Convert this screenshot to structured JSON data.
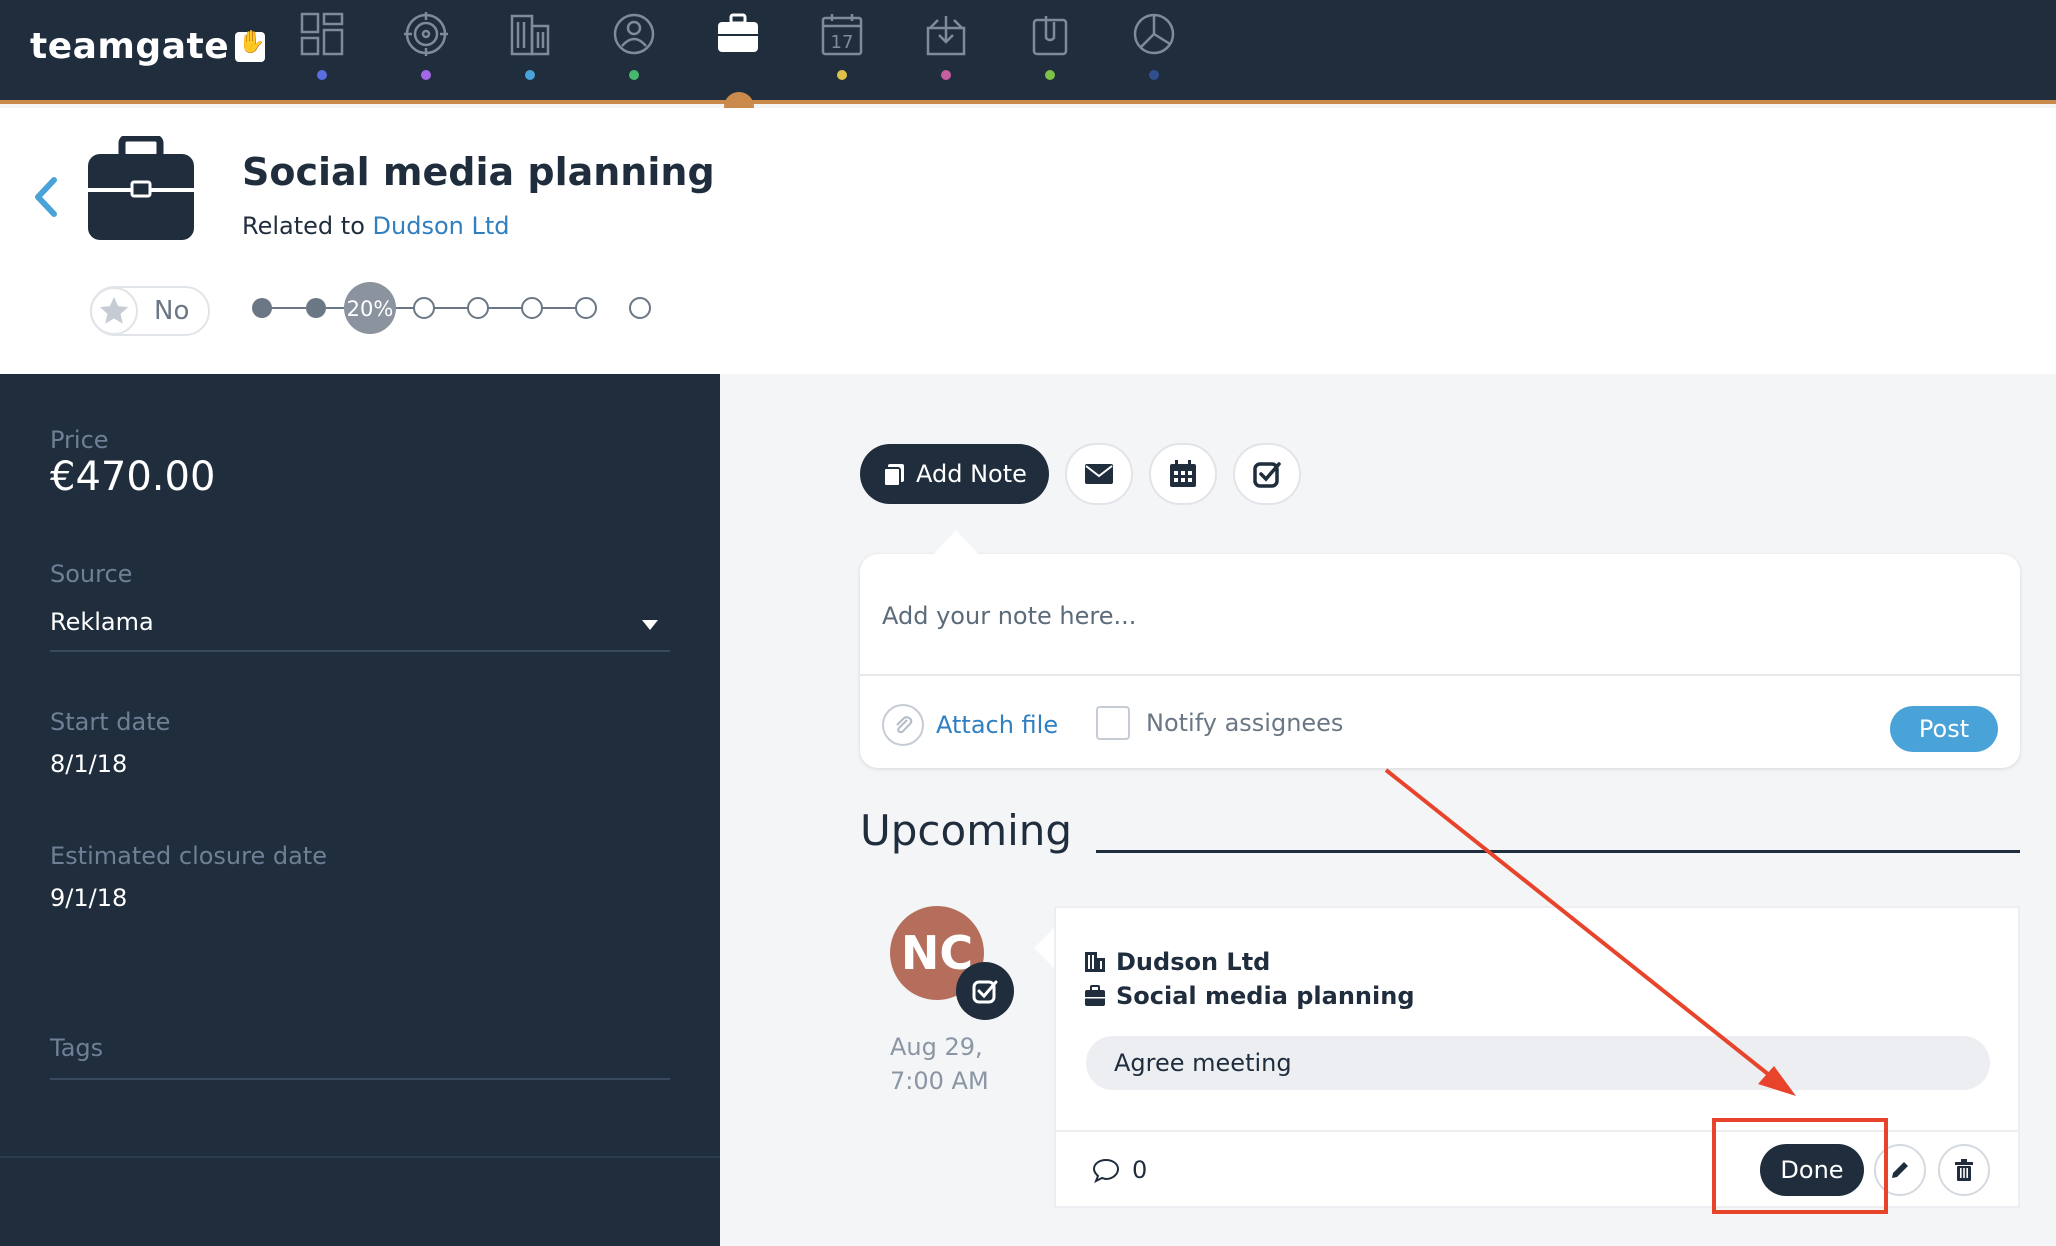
{
  "app": {
    "logo_text": "teamgate",
    "nav": [
      {
        "icon": "dashboard-icon",
        "dot_color": "#5b6ee1"
      },
      {
        "icon": "target-icon",
        "dot_color": "#a368e6"
      },
      {
        "icon": "building-icon",
        "dot_color": "#4aa3d8"
      },
      {
        "icon": "contacts-icon",
        "dot_color": "#47b86d"
      },
      {
        "icon": "briefcase-icon",
        "dot_color": "#c98a4b",
        "active": true
      },
      {
        "icon": "calendar-icon",
        "dot_color": "#e0c14a"
      },
      {
        "icon": "inbox-icon",
        "dot_color": "#c65ea0"
      },
      {
        "icon": "attachments-icon",
        "dot_color": "#7ec04a"
      },
      {
        "icon": "reports-icon",
        "dot_color": "#2f4f8f"
      }
    ]
  },
  "header": {
    "title": "Social media planning",
    "related_prefix": "Related to",
    "related_link": "Dudson Ltd",
    "favorite_label": "No",
    "pipeline": {
      "progress_label": "20%",
      "stages_total": 8,
      "current_stage": 3
    }
  },
  "sidebar": {
    "price_label": "Price",
    "price_value": "€470.00",
    "source_label": "Source",
    "source_value": "Reklama",
    "start_label": "Start date",
    "start_value": "8/1/18",
    "close_label": "Estimated closure date",
    "close_value": "9/1/18",
    "tags_label": "Tags"
  },
  "composer": {
    "add_note_label": "Add Note",
    "note_placeholder": "Add your note here...",
    "attach_label": "Attach file",
    "notify_label": "Notify assignees",
    "post_label": "Post"
  },
  "upcoming": {
    "title": "Upcoming",
    "activity": {
      "avatar_initials": "NC",
      "avatar_color": "#b56e5b",
      "date_line1": "Aug 29,",
      "date_line2": "7:00 AM",
      "company": "Dudson Ltd",
      "deal": "Social media planning",
      "text": "Agree meeting",
      "comment_count": "0",
      "done_label": "Done"
    }
  },
  "colors": {
    "nav_bg": "#1f2d3d",
    "accent_orange": "#c98a4b",
    "link_blue": "#2f7fc1",
    "post_blue": "#4aa3d8",
    "annotation_red": "#e8442c"
  }
}
